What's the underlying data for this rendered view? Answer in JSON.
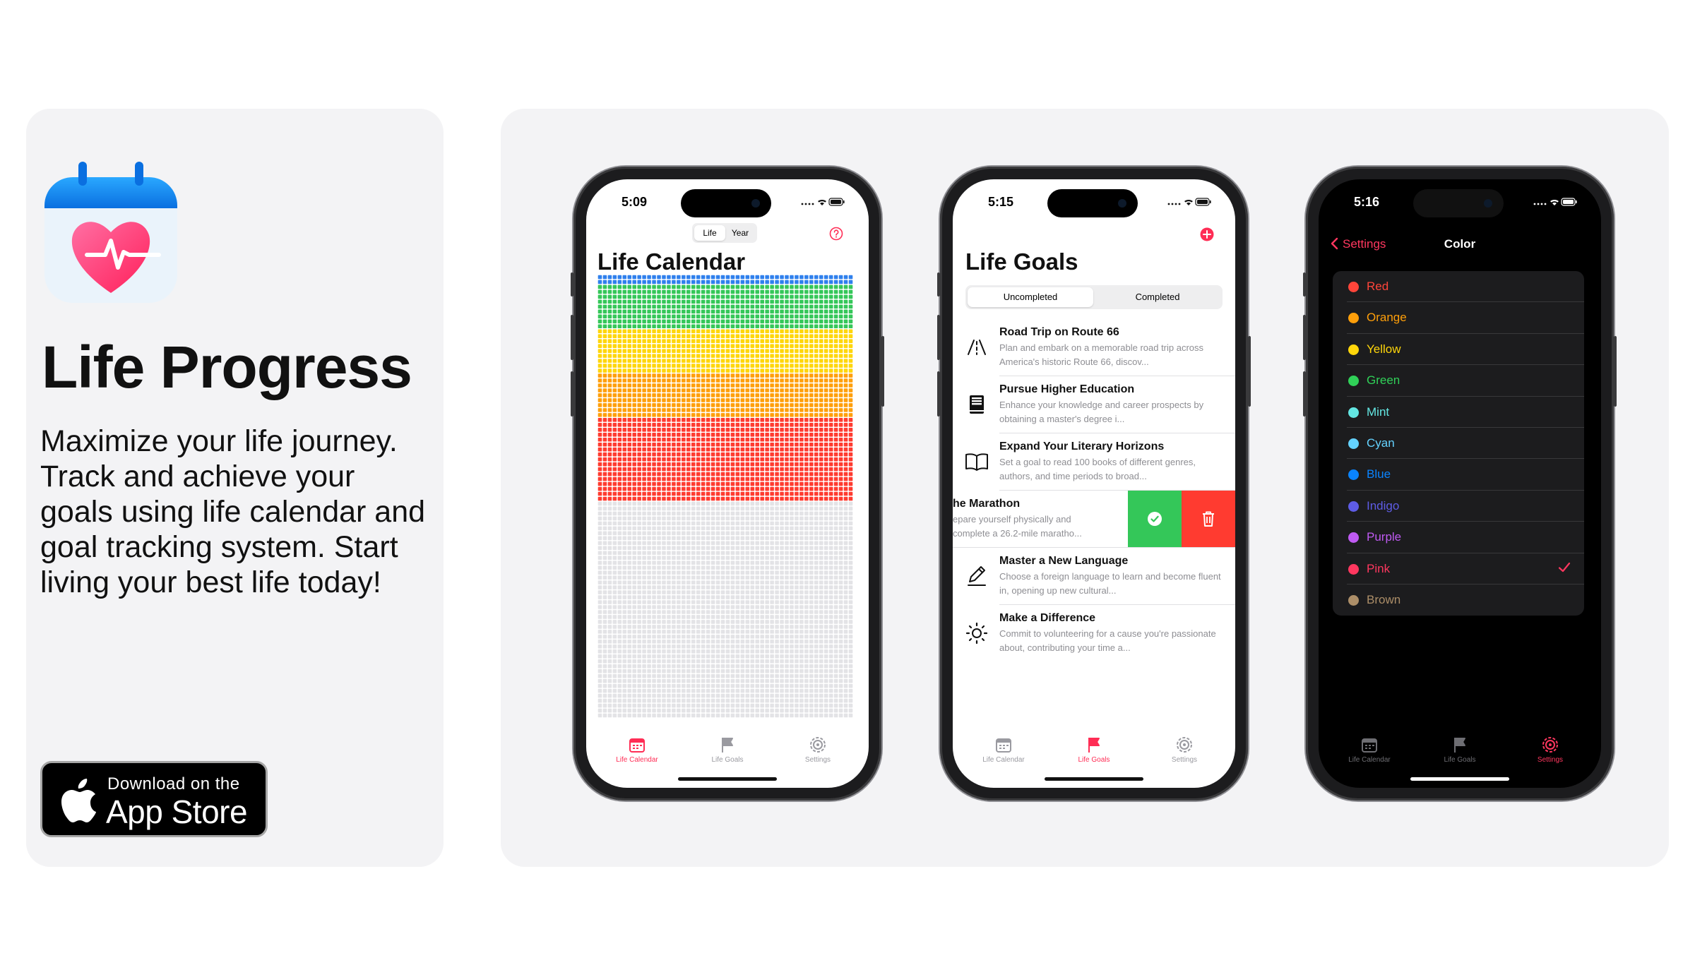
{
  "promo": {
    "app_name": "Life Progress",
    "tagline": "Maximize your life journey. Track and achieve your goals using life calendar and goal tracking system. Start living your best life today!",
    "badge_line1": "Download on the",
    "badge_line2": "App Store"
  },
  "phone1": {
    "time": "5:09",
    "segments": [
      "Life",
      "Year"
    ],
    "title": "Life Calendar",
    "tabs": [
      "Life Calendar",
      "Life Goals",
      "Settings"
    ],
    "grid": {
      "columns": 52,
      "rows": 90,
      "bands": [
        {
          "color": "#2f80ed",
          "rows": 2
        },
        {
          "color": "#35c759",
          "rows": 9
        },
        {
          "color": "#ffd60a",
          "rows": 9
        },
        {
          "color": "#ff9f0a",
          "rows": 9
        },
        {
          "color": "#ff3b30",
          "rows": 17
        },
        {
          "color": "#e3e3e6",
          "rows": 44
        }
      ]
    }
  },
  "phone2": {
    "time": "5:15",
    "title": "Life Goals",
    "segments": [
      "Uncompleted",
      "Completed"
    ],
    "goals": [
      {
        "title": "Road Trip on Route 66",
        "desc": "Plan and embark on a memorable road trip across America's historic Route 66, discov...",
        "icon": "road-icon"
      },
      {
        "title": "Pursue Higher Education",
        "desc": "Enhance your knowledge and career prospects by obtaining a master's degree i...",
        "icon": "book-closed-icon"
      },
      {
        "title": "Expand Your Literary Horizons",
        "desc": "Set a goal to read 100 books of different genres, authors, and time periods to broad...",
        "icon": "book-open-icon"
      },
      {
        "title": "he Marathon",
        "desc": "epare yourself physically and complete a 26.2-mile maratho...",
        "icon": "run-icon"
      },
      {
        "title": "Master a New Language",
        "desc": "Choose a foreign language to learn and become fluent in, opening up new cultural...",
        "icon": "pen-icon"
      },
      {
        "title": "Make a Difference",
        "desc": "Commit to volunteering for a cause you're passionate about, contributing your time a...",
        "icon": "sun-icon"
      }
    ],
    "tabs": [
      "Life Calendar",
      "Life Goals",
      "Settings"
    ]
  },
  "phone3": {
    "time": "5:16",
    "back_label": "Settings",
    "title": "Color",
    "selected": "Pink",
    "colors": [
      {
        "name": "Red",
        "hex": "#ff453a"
      },
      {
        "name": "Orange",
        "hex": "#ff9f0a"
      },
      {
        "name": "Yellow",
        "hex": "#ffd60a"
      },
      {
        "name": "Green",
        "hex": "#30d158"
      },
      {
        "name": "Mint",
        "hex": "#63e6e2"
      },
      {
        "name": "Cyan",
        "hex": "#64d2ff"
      },
      {
        "name": "Blue",
        "hex": "#0a84ff"
      },
      {
        "name": "Indigo",
        "hex": "#5e5ce6"
      },
      {
        "name": "Purple",
        "hex": "#bf5af2"
      },
      {
        "name": "Pink",
        "hex": "#ff375f"
      },
      {
        "name": "Brown",
        "hex": "#ac8e68"
      }
    ],
    "tabs": [
      "Life Calendar",
      "Life Goals",
      "Settings"
    ]
  },
  "theme": {
    "accent": "#ff2d55",
    "panel": "#f3f3f5"
  }
}
